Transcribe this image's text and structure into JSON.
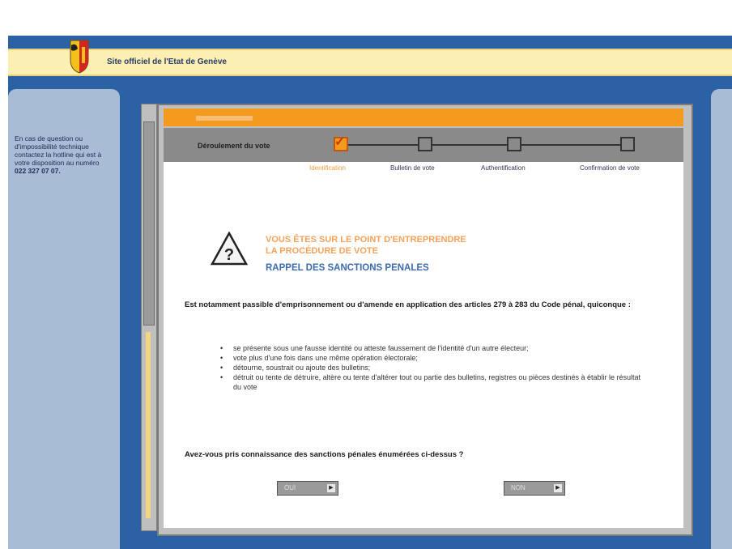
{
  "header": {
    "site_title": "Site officiel de l'Etat de Genève",
    "logo_icon": "geneva-coat-of-arms-icon"
  },
  "sidebar": {
    "help_text": "En cas de question ou d'impossibilité technique contactez la hotline qui est à votre disposition au numéro",
    "phone": "022 327 07 07."
  },
  "steps": {
    "label": "Déroulement du vote",
    "items": [
      {
        "label": "Identification",
        "active": true
      },
      {
        "label": "Bulletin de vote",
        "active": false
      },
      {
        "label": "Authentification",
        "active": false
      },
      {
        "label": "Confirmation de vote",
        "active": false
      }
    ]
  },
  "content": {
    "warning_icon": "question-warning-icon",
    "title_line1": "VOUS ÊTES SUR LE POINT D'ENTREPRENDRE",
    "title_line2": "LA PROCÉDURE DE VOTE",
    "title_line3": "RAPPEL DES SANCTIONS PENALES",
    "intro": "Est notamment passible d'emprisonnement ou d'amende en application des articles 279 à 283 du Code pénal, quiconque :",
    "bullets": [
      "se présente sous une fausse identité ou atteste faussement de l'identité d'un autre électeur;",
      "vote plus d'une fois dans une même opération électorale;",
      "détourne, soustrait ou ajoute des bulletins;",
      "détruit ou tente de détruire, altère ou tente d'altérer tout ou partie des bulletins, registres ou pièces destinés à établir le résultat du vote"
    ],
    "question": "Avez-vous pris connaissance des sanctions pénales énumérées ci-dessus ?"
  },
  "buttons": {
    "yes": "OUI",
    "no": "NON"
  },
  "colors": {
    "frame_blue": "#2a62a4",
    "banner_yellow": "#fbefb2",
    "accent_orange": "#f39a1f",
    "title_blue": "#3c6bb0"
  }
}
